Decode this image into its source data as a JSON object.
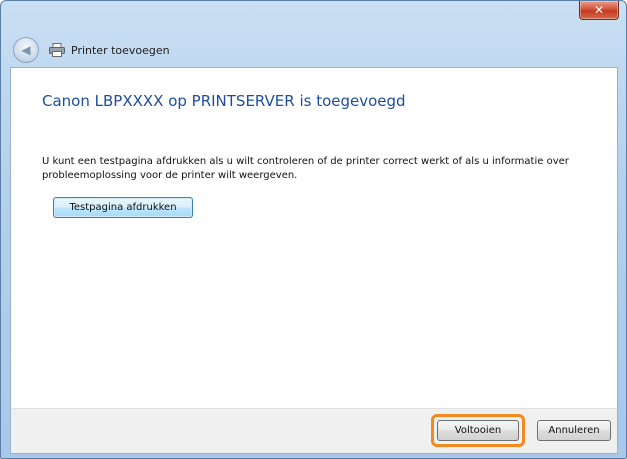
{
  "window": {
    "close_label": "✕"
  },
  "nav": {
    "title": "Printer toevoegen"
  },
  "main": {
    "heading": "Canon LBPXXXX op PRINTSERVER is toegevoegd",
    "description": "U kunt een testpagina afdrukken als u wilt controleren of de printer correct werkt of als u informatie over probleemoplossing voor de printer wilt weergeven.",
    "test_page_label": "Testpagina afdrukken"
  },
  "footer": {
    "finish_label": "Voltooien",
    "cancel_label": "Annuleren"
  },
  "colors": {
    "heading": "#1e4e9c",
    "highlight": "#f28a1f",
    "close": "#c43a1e"
  },
  "icons": {
    "back": "back-arrow-icon",
    "printer": "printer-icon",
    "close": "close-icon"
  }
}
